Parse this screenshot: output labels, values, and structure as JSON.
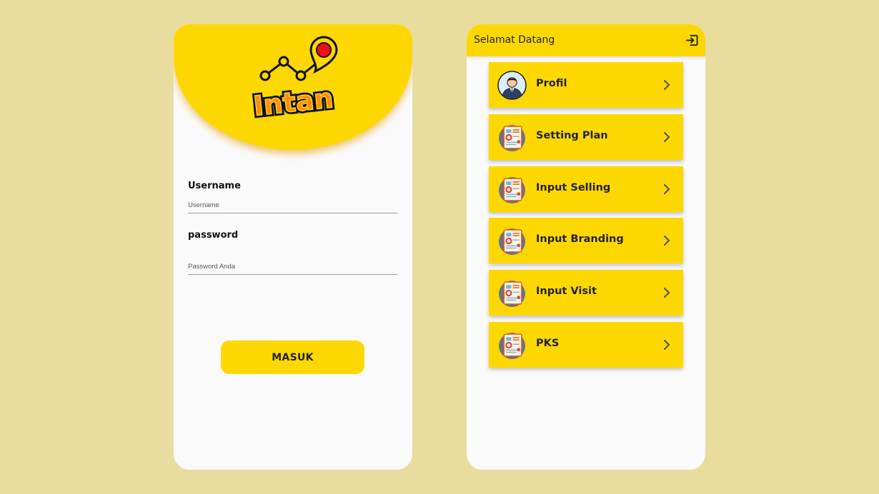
{
  "login": {
    "logo_text": "Intan",
    "username_label": "Username",
    "username_placeholder": "Username",
    "password_label": "password",
    "password_placeholder": "Password Anda",
    "submit_label": "MASUK"
  },
  "menu": {
    "title": "Selamat Datang",
    "logout_icon": "logout-icon",
    "items": [
      {
        "label": "Profil",
        "icon": "user-avatar-icon"
      },
      {
        "label": "Setting Plan",
        "icon": "report-document-icon"
      },
      {
        "label": "Input Selling",
        "icon": "report-document-icon"
      },
      {
        "label": "Input Branding",
        "icon": "report-document-icon"
      },
      {
        "label": "Input Visit",
        "icon": "report-document-icon"
      },
      {
        "label": "PKS",
        "icon": "report-document-icon"
      }
    ]
  },
  "colors": {
    "background": "#e8dd9f",
    "accent": "#fdd800",
    "screen": "#fafafa"
  }
}
